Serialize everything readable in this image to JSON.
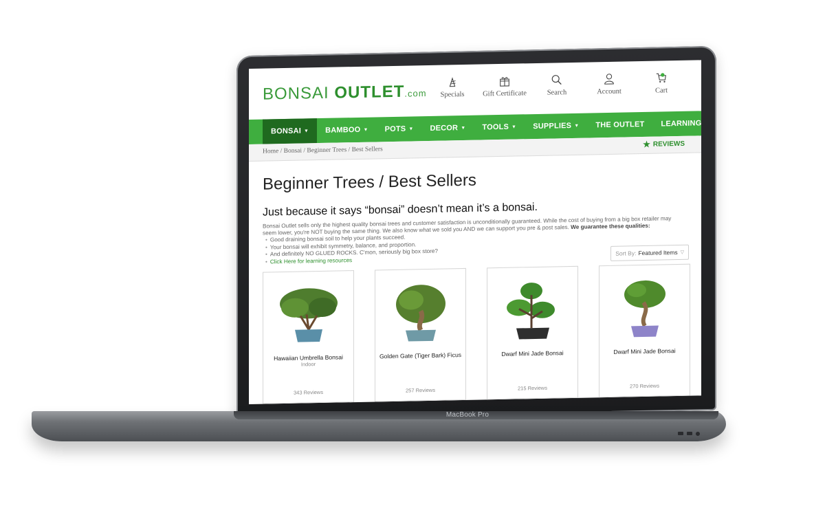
{
  "device": {
    "model_label": "MacBook Pro"
  },
  "site": {
    "logo": {
      "part1": "BONSAI",
      "part2": "OUTLET",
      "suffix": ".com"
    },
    "header_icons": [
      {
        "icon": "sparkle-flower-icon",
        "label": "Specials"
      },
      {
        "icon": "gift-icon",
        "label": "Gift Certificate"
      },
      {
        "icon": "search-icon",
        "label": "Search"
      },
      {
        "icon": "user-icon",
        "label": "Account"
      },
      {
        "icon": "cart-icon",
        "label": "Cart"
      }
    ],
    "nav": [
      {
        "label": "BONSAI",
        "caret": "▼"
      },
      {
        "label": "BAMBOO",
        "caret": "▼"
      },
      {
        "label": "POTS",
        "caret": "▼"
      },
      {
        "label": "DECOR",
        "caret": "▼"
      },
      {
        "label": "TOOLS",
        "caret": "▼"
      },
      {
        "label": "SUPPLIES",
        "caret": "▼"
      },
      {
        "label": "THE OUTLET",
        "caret": ""
      },
      {
        "label": "LEARNING RESOURCES",
        "caret": ""
      }
    ],
    "breadcrumb": "Home / Bonsai / Beginner Trees / Best Sellers",
    "reviews_link": "REVIEWS",
    "colors": {
      "brand_green": "#3fae3f",
      "nav_active": "#1f6a1f",
      "link_green": "#2d8f2d"
    }
  },
  "main": {
    "title": "Beginner Trees / Best Sellers",
    "subhead": "Just because it says “bonsai” doesn’t mean it’s a bonsai.",
    "intro": "Bonsai Outlet sells only the highest quality bonsai trees and customer satisfaction is unconditionally guaranteed. While the cost of buying from a big box retailer may seem lower, you're NOT buying the same thing. We also know what we sold you AND we can support you pre & post sales.",
    "intro_bold": "We guarantee these qualities:",
    "bullets": [
      "Good draining bonsai soil to help your plants succeed.",
      "Your bonsai will exhibit symmetry, balance, and proportion.",
      "And definitely NO GLUED ROCKS. C'mon, seriously big box store?"
    ],
    "learning_link": "Click Here for learning resources",
    "sort": {
      "label": "Sort By:",
      "value": "Featured Items"
    },
    "products": [
      {
        "name": "Hawaiian Umbrella Bonsai",
        "tag": "Indoor",
        "reviews": "343 Reviews",
        "pot_color": "#5a8fa8"
      },
      {
        "name": "Golden Gate (Tiger Bark) Ficus",
        "tag": "",
        "reviews": "257 Reviews",
        "pot_color": "#6f9aa6"
      },
      {
        "name": "Dwarf Mini Jade Bonsai",
        "tag": "",
        "reviews": "215 Reviews",
        "pot_color": "#2e2e2e"
      },
      {
        "name": "Dwarf Mini Jade Bonsai",
        "tag": "",
        "reviews": "270 Reviews",
        "pot_color": "#8e84c9"
      }
    ]
  }
}
